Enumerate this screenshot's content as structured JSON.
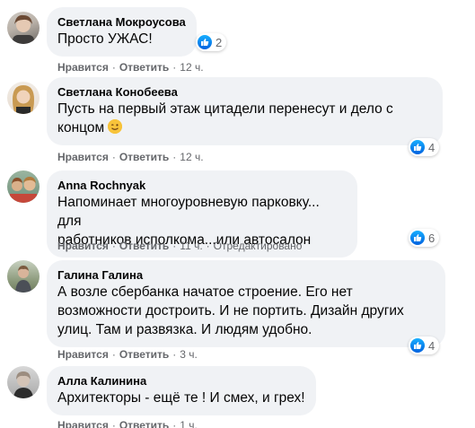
{
  "comments": [
    {
      "author": "Светлана Мокроусова",
      "text_lines": [
        "Просто УЖАС!"
      ],
      "emoji": false,
      "reaction_count": "2",
      "like": "Нравится",
      "reply": "Ответить",
      "time": "12 ч.",
      "edited": ""
    },
    {
      "author": "Светлана Конобеева",
      "text_lines": [
        "Пусть на первый этаж цитадели перенесут и дело с",
        "концом"
      ],
      "emoji": true,
      "reaction_count": "4",
      "like": "Нравится",
      "reply": "Ответить",
      "time": "12 ч.",
      "edited": ""
    },
    {
      "author": "Anna Rochnyak",
      "text_lines": [
        "Напоминает многоуровневую парковку... для",
        "работников исполкома...или автосалон"
      ],
      "emoji": false,
      "reaction_count": "6",
      "like": "Нравится",
      "reply": "Ответить",
      "time": "11 ч.",
      "edited": "Отредактировано"
    },
    {
      "author": "Галина Галина",
      "text_lines": [
        "А возле сбербанка начатое строение. Его нет",
        "возможности достроить. И не портить. Дизайн других",
        "улиц. Там и развязка. И людям удобно."
      ],
      "emoji": false,
      "reaction_count": "4",
      "like": "Нравится",
      "reply": "Ответить",
      "time": "3 ч.",
      "edited": ""
    },
    {
      "author": "Алла Калинина",
      "text_lines": [
        "Архитекторы - ещё те ! И смех, и грех!"
      ],
      "emoji": false,
      "reaction_count": "",
      "like": "Нравится",
      "reply": "Ответить",
      "time": "1 ч.",
      "edited": ""
    }
  ],
  "colors": {
    "bubble": "#f0f2f5",
    "meta": "#65676b",
    "like_blue": "#1877f2"
  },
  "icons": [
    "like-icon",
    "smiley-wink-emoji"
  ]
}
